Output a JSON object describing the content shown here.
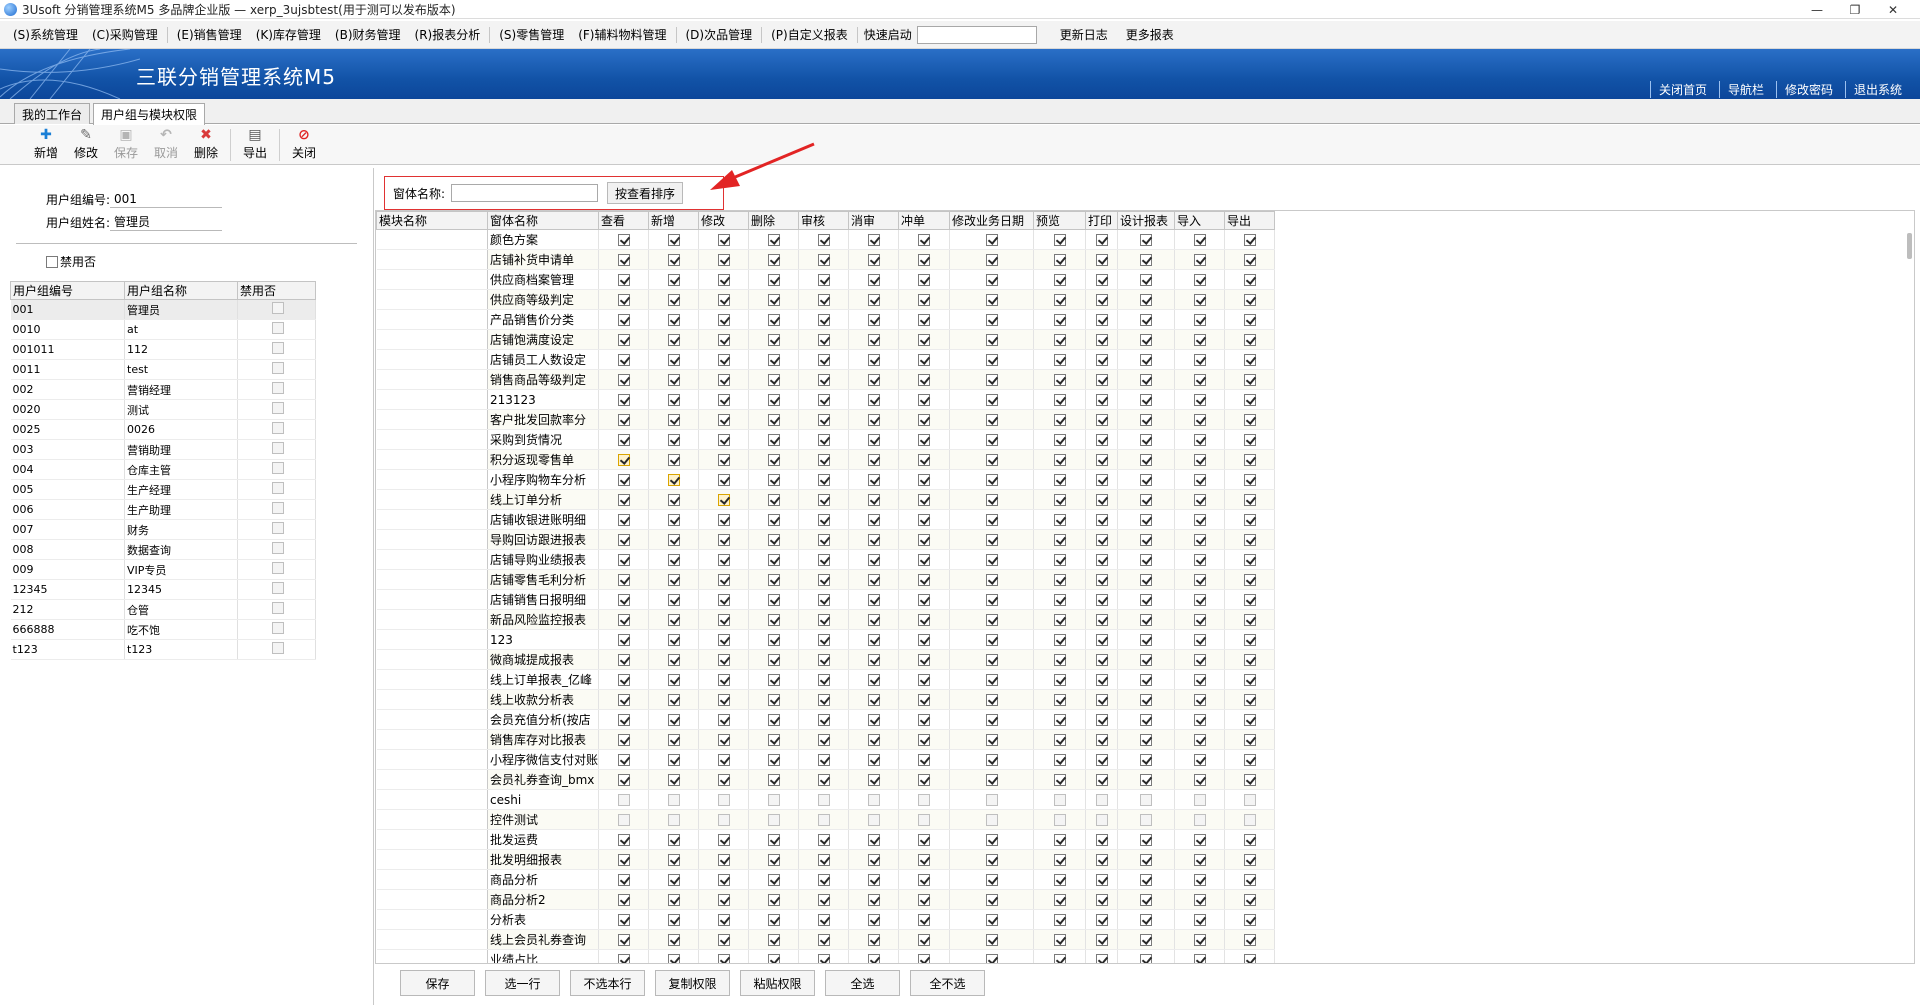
{
  "window": {
    "title": "3Usoft 分销管理系统M5 多品牌企业版 — xerp_3ujsbtest(用于测可以发布版本)",
    "controls": [
      "—",
      "❐",
      "✕"
    ]
  },
  "menubar": {
    "items": [
      "(S)系统管理",
      "(C)采购管理",
      "(E)销售管理",
      "(K)库存管理",
      "(B)财务管理",
      "(R)报表分析",
      "(S)零售管理",
      "(F)辅料物料管理",
      "(D)次品管理",
      "(P)自定义报表"
    ],
    "quick_start_label": "快速启动",
    "quick_start_value": "",
    "extra": [
      "更新日志",
      "更多报表"
    ]
  },
  "banner": {
    "product_name": "三联分销管理系统M5",
    "links": [
      "关闭首页",
      "导航栏",
      "修改密码",
      "退出系统"
    ],
    "bg_color": "#1253a7"
  },
  "tabs": [
    "我的工作台",
    "用户组与模块权限"
  ],
  "toolbar": {
    "buttons": [
      {
        "label": "新增",
        "icon": "plus-icon",
        "enabled": true
      },
      {
        "label": "修改",
        "icon": "edit-icon",
        "enabled": true
      },
      {
        "label": "保存",
        "icon": "save-icon",
        "enabled": false
      },
      {
        "label": "取消",
        "icon": "undo-icon",
        "enabled": false
      },
      {
        "label": "删除",
        "icon": "delete-icon",
        "enabled": true
      },
      {
        "label": "导出",
        "icon": "export-icon",
        "enabled": true
      },
      {
        "label": "关闭",
        "icon": "close-icon",
        "enabled": true
      }
    ]
  },
  "left": {
    "group_code_label": "用户组编号:",
    "group_code": "001",
    "group_name_label": "用户组姓名:",
    "group_name": "管理员",
    "disable_label": "禁用否",
    "columns": [
      "用户组编号",
      "用户组名称",
      "禁用否"
    ],
    "rows": [
      [
        "001",
        "管理员"
      ],
      [
        "0010",
        "at"
      ],
      [
        "001011",
        "112"
      ],
      [
        "0011",
        "test"
      ],
      [
        "002",
        "营销经理"
      ],
      [
        "0020",
        "测试"
      ],
      [
        "0025",
        "0026"
      ],
      [
        "003",
        "营销助理"
      ],
      [
        "004",
        "仓库主管"
      ],
      [
        "005",
        "生产经理"
      ],
      [
        "006",
        "生产助理"
      ],
      [
        "007",
        "财务"
      ],
      [
        "008",
        "数据查询"
      ],
      [
        "009",
        "VIP专员"
      ],
      [
        "12345",
        "12345"
      ],
      [
        "212",
        "仓管"
      ],
      [
        "666888",
        "吃不饱"
      ],
      [
        "t123",
        "t123"
      ]
    ]
  },
  "right": {
    "search_label": "窗体名称:",
    "search_value": "",
    "sort_button": "按查看排序",
    "columns": [
      "模块名称",
      "窗体名称",
      "查看",
      "新增",
      "修改",
      "删除",
      "审核",
      "消审",
      "冲单",
      "修改业务日期",
      "预览",
      "打印",
      "设计报表",
      "导入",
      "导出"
    ],
    "rows": [
      "颜色方案",
      "店铺补货申请单",
      "供应商档案管理",
      "供应商等级判定",
      "产品销售价分类",
      "店铺饱满度设定",
      "店铺员工人数设定",
      "销售商品等级判定",
      "213123",
      "客户批发回款率分",
      "采购到货情况",
      "积分返现零售单",
      "小程序购物车分析",
      "线上订单分析",
      "店铺收银进账明细",
      "导购回访跟进报表",
      "店铺导购业绩报表",
      "店铺零售毛利分析",
      "店铺销售日报明细",
      "新品风险监控报表",
      "123",
      "微商城提成报表",
      "线上订单报表_亿峰",
      "线上收款分析表",
      "会员充值分析(按店",
      "销售库存对比报表",
      "小程序微信支付对账",
      "会员礼券查询_bmx",
      "ceshi",
      "控件测试",
      "批发运费",
      "批发明细报表",
      "商品分析",
      "商品分析2",
      "分析表",
      "线上会员礼券查询",
      "业绩占比"
    ],
    "unchecked_rows": [
      "ceshi",
      "控件测试"
    ],
    "highlight_cells": [
      [
        "积分返现零售单",
        "查看"
      ],
      [
        "小程序购物车分析",
        "新增"
      ],
      [
        "线上订单分析",
        "修改"
      ]
    ]
  },
  "bottom_buttons": [
    "保存",
    "选一行",
    "不选本行",
    "复制权限",
    "粘贴权限",
    "全选",
    "全不选"
  ]
}
